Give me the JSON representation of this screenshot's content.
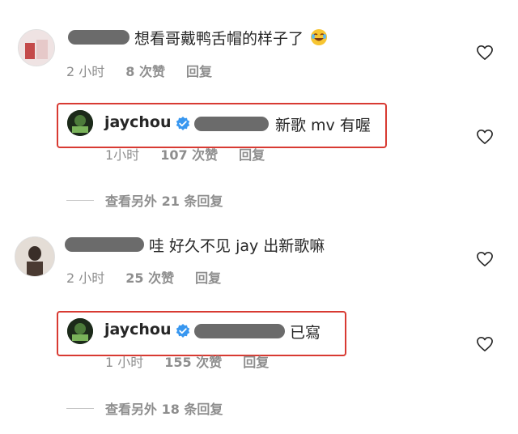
{
  "comments": [
    {
      "text": "想看哥戴鸭舌帽的样子了",
      "emoji": "😂",
      "time": "2 小时",
      "likes": "8 次赞",
      "reply": "回复",
      "replies": [
        {
          "username": "jaychou",
          "text": "新歌 mv 有喔",
          "time": "1小时",
          "likes": "107 次赞",
          "reply": "回复"
        }
      ],
      "view_more": "查看另外 21 条回复"
    },
    {
      "text": "哇 好久不见 jay 出新歌嘛",
      "time": "2 小时",
      "likes": "25 次赞",
      "reply": "回复",
      "replies": [
        {
          "username": "jaychou",
          "text": "已寫",
          "time": "1 小时",
          "likes": "155 次赞",
          "reply": "回复"
        }
      ],
      "view_more": "查看另外 18 条回复"
    }
  ],
  "colors": {
    "highlight": "#d83a32",
    "verified": "#3897f0",
    "meta": "#8e8e8e"
  }
}
